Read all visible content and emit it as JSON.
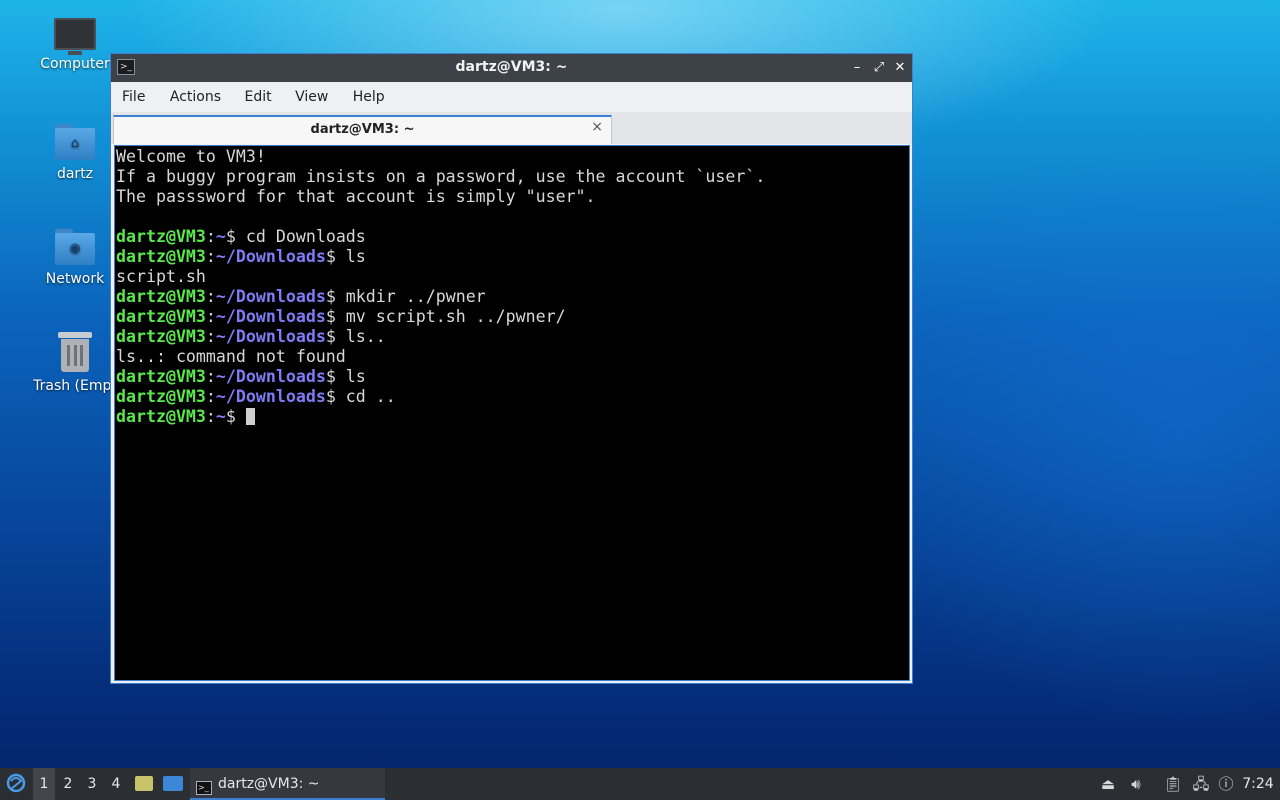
{
  "desktop": {
    "icons": [
      {
        "label": "Computer"
      },
      {
        "label": "dartz"
      },
      {
        "label": "Network"
      },
      {
        "label": "Trash (Empt"
      }
    ]
  },
  "window": {
    "title": "dartz@VM3: ~",
    "menu": [
      "File",
      "Actions",
      "Edit",
      "View",
      "Help"
    ],
    "tab_label": "dartz@VM3: ~",
    "tab_close": "×",
    "controls": {
      "minimize": "–",
      "maximize": "⤢",
      "close": "✕"
    }
  },
  "terminal": {
    "lines": [
      {
        "type": "out",
        "text": "Welcome to VM3!"
      },
      {
        "type": "out",
        "text": "If a buggy program insists on a password, use the account `user`."
      },
      {
        "type": "out",
        "text": "The passsword for that account is simply \"user\"."
      },
      {
        "type": "out",
        "text": ""
      },
      {
        "type": "cmd",
        "user": "dartz@VM3",
        "path": "~",
        "cmd": "cd Downloads"
      },
      {
        "type": "cmd",
        "user": "dartz@VM3",
        "path": "~/Downloads",
        "cmd": "ls"
      },
      {
        "type": "out",
        "text": "script.sh"
      },
      {
        "type": "cmd",
        "user": "dartz@VM3",
        "path": "~/Downloads",
        "cmd": "mkdir ../pwner"
      },
      {
        "type": "cmd",
        "user": "dartz@VM3",
        "path": "~/Downloads",
        "cmd": "mv script.sh ../pwner/"
      },
      {
        "type": "cmd",
        "user": "dartz@VM3",
        "path": "~/Downloads",
        "cmd": "ls.."
      },
      {
        "type": "out",
        "text": "ls..: command not found"
      },
      {
        "type": "cmd",
        "user": "dartz@VM3",
        "path": "~/Downloads",
        "cmd": "ls"
      },
      {
        "type": "cmd",
        "user": "dartz@VM3",
        "path": "~/Downloads",
        "cmd": "cd .."
      },
      {
        "type": "cmd",
        "user": "dartz@VM3",
        "path": "~",
        "cmd": "",
        "cursor": true
      }
    ]
  },
  "taskbar": {
    "workspaces": [
      "1",
      "2",
      "3",
      "4"
    ],
    "active_workspace": "1",
    "task_label": "dartz@VM3: ~",
    "clock": "7:24",
    "colors": {
      "accent": "#3d7fd0",
      "prompt_user": "#5ae84d",
      "prompt_path": "#7f7cf5"
    }
  }
}
